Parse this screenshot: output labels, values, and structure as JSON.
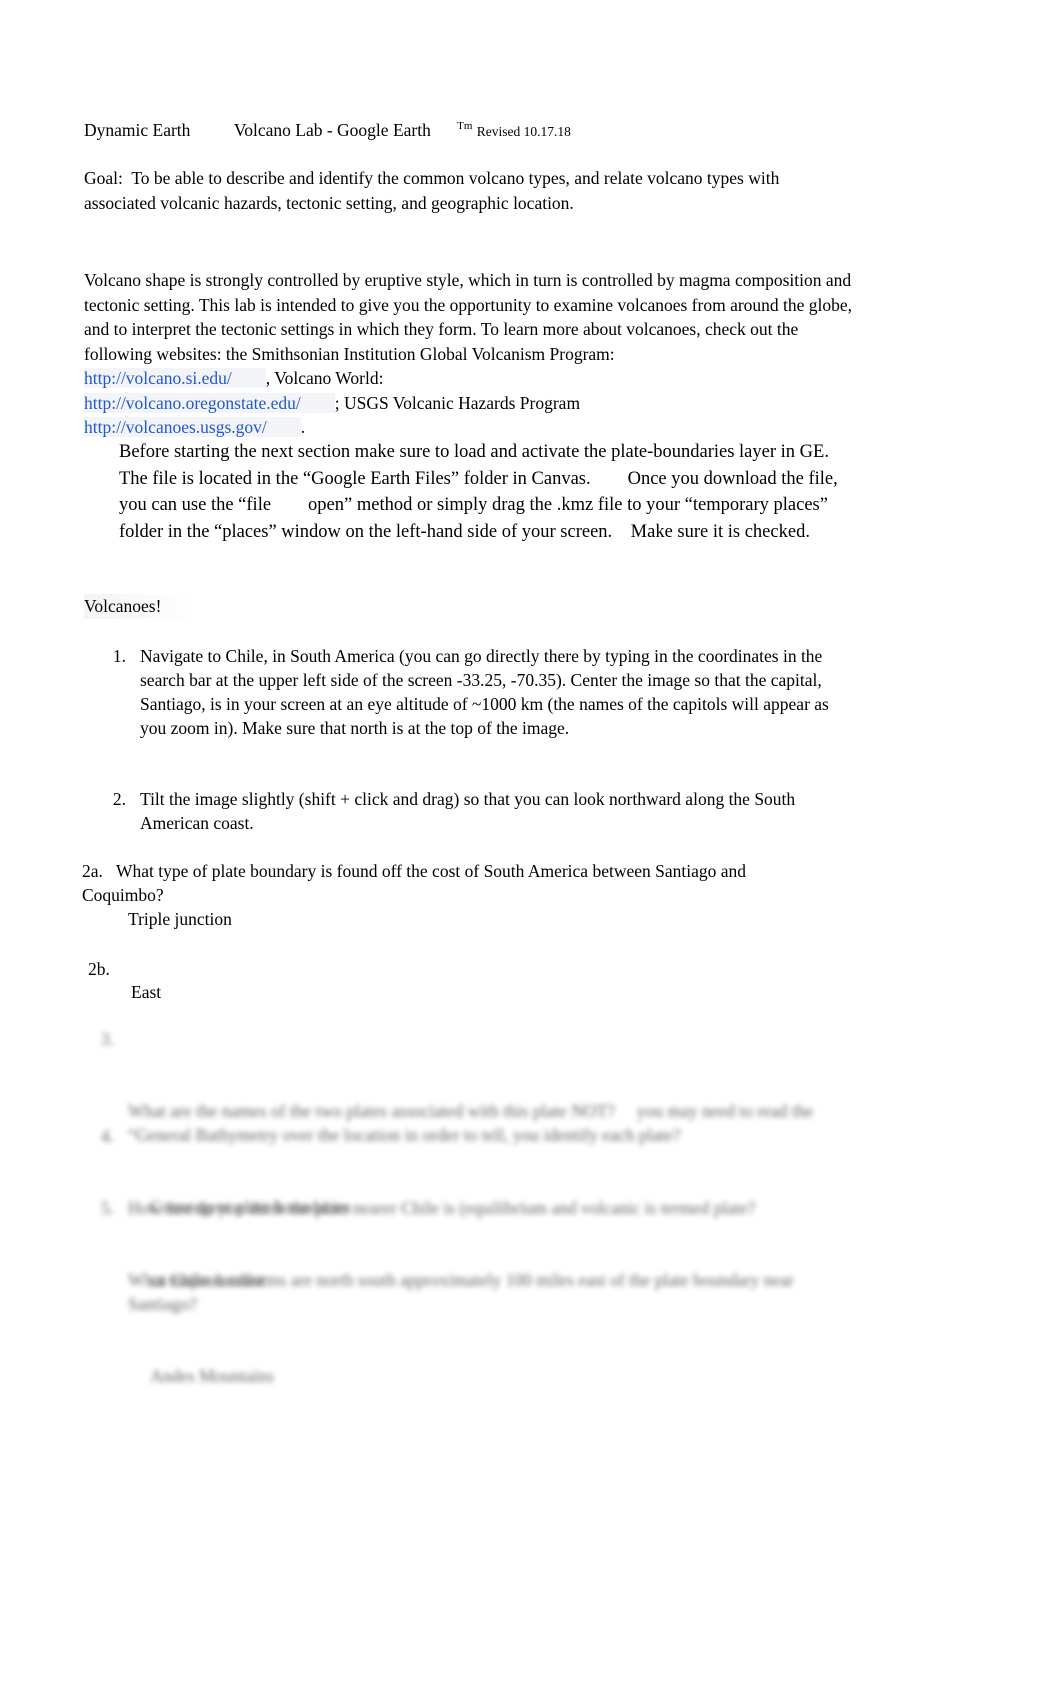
{
  "document": {
    "header": {
      "course": "Dynamic Earth",
      "title": "Volcano Lab - Google Earth",
      "trademark": "Tm",
      "revision": "Revised 10.17.18"
    },
    "goal": "Goal:  To be able to describe and identify the common volcano types, and relate volcano types with associated volcanic hazards, tectonic setting, and geographic location.",
    "intro": {
      "part1": "Volcano shape is strongly controlled by eruptive style, which in turn is controlled by magma composition and tectonic setting. This lab is intended to give you the opportunity to examine volcanoes from around the globe, and to interpret the tectonic settings in which they form. To learn more about volcanoes, check out the following websites: the Smithsonian Institution Global Volcanism Program:",
      "link1": "http://volcano.si.edu/",
      "part2": ", Volcano World:",
      "link2": "http://volcano.oregonstate.edu/",
      "part3": "; USGS Volcanic Hazards Program",
      "link3": "http://volcanoes.usgs.gov/",
      "part4": "."
    },
    "note": "Before starting the next section make sure to load and activate the plate-boundaries layer in GE.   The file is located in the “Google Earth Files” folder in Canvas.        Once you download the file, you can use the “file        open” method or simply drag the .kmz file to your “temporary places” folder in the “places” window on the left-hand side of your screen.    Make sure it is checked.",
    "section_heading": "Volcanoes!",
    "steps": [
      {
        "number": "1.",
        "text": "Navigate to Chile, in South America        (you can go directly there by typing in the coordinates in the search bar at the upper left side of the screen              -33.25, -70.35). Center the image so that the capital, Santiago, is in your screen at an eye altitude of ~1000 km (the names of the capitols will appear as you zoom in). Make sure that north is at the top of the image."
      },
      {
        "number": "2.",
        "text": "Tilt the image slightly (shift + click and drag) so that you can look northward along the South American coast."
      }
    ],
    "questions": [
      {
        "label": "2a.",
        "question": "What type of plate boundary is found off the cost of South America between Santiago and Coquimbo?",
        "answer": "Triple junction"
      },
      {
        "label": "2b.",
        "question": "",
        "answer": "East"
      }
    ],
    "redacted": [
      {
        "number": "3.",
        "text": "What are the names of the two plates associated with this plate NOT?     you may need to read the “General Bathymetry over the location in order to tell, you identify each plate?",
        "answer": "Convergent plate boundaries"
      },
      {
        "number": "4.",
        "text": "How fast do you think the plate nearer Chile is (equilibrium and volcanic is termed plate?",
        "answer": "ca Chilean coast"
      },
      {
        "number": "5.",
        "text": "What major landforms are north south approximately 100 miles east of the plate boundary near Santiago?",
        "answer": "Andes Mountains"
      }
    ]
  }
}
